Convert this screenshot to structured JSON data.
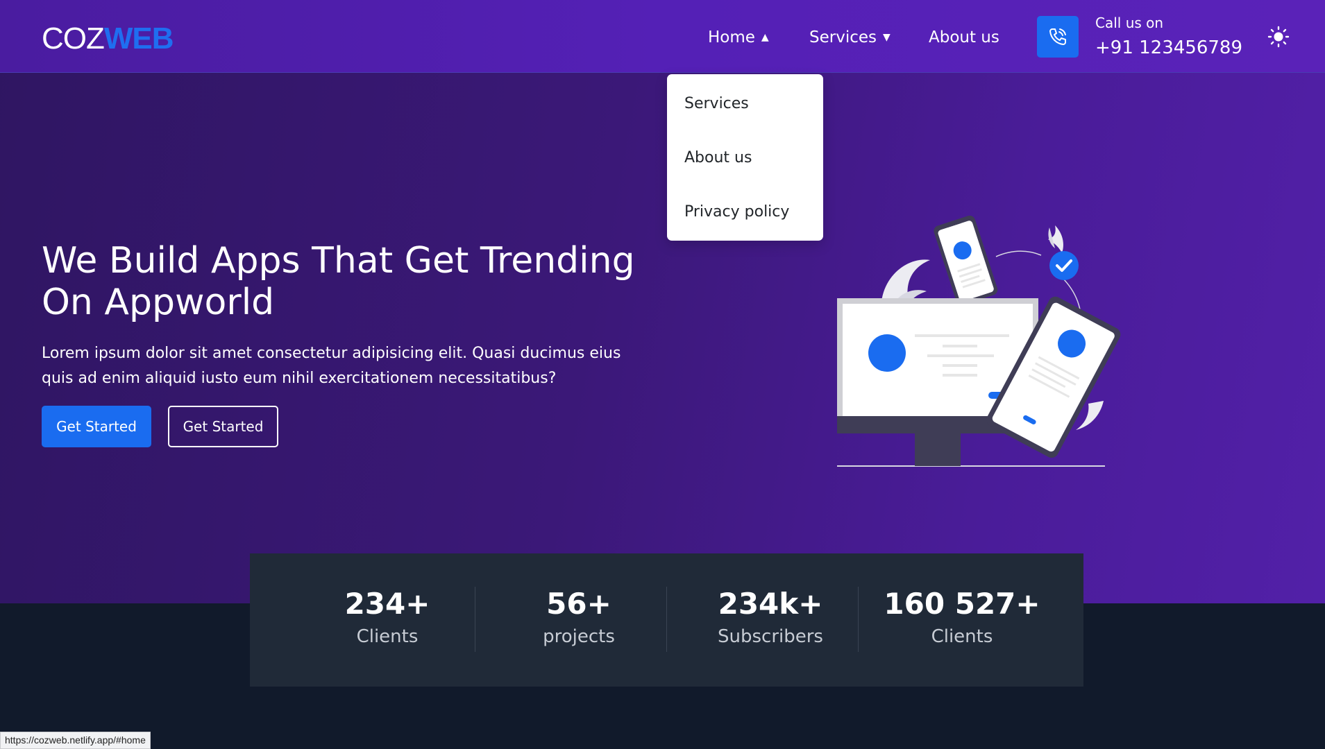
{
  "brand": {
    "part1": "COZ",
    "part2": "WEB"
  },
  "nav": {
    "home": "Home",
    "services": "Services",
    "about": "About us",
    "call_label": "Call us on",
    "call_number": "+91 123456789"
  },
  "dropdown": {
    "items": [
      "Services",
      "About us",
      "Privacy policy"
    ]
  },
  "hero": {
    "title": "We Build Apps That Get Trending On Appworld",
    "text": "Lorem ipsum dolor sit amet consectetur adipisicing elit. Quasi ducimus eius quis ad enim aliquid iusto eum nihil exercitationem necessitatibus?",
    "primary_button": "Get Started",
    "secondary_button": "Get Started"
  },
  "stats": [
    {
      "value": "234+",
      "label": "Clients"
    },
    {
      "value": "56+",
      "label": "projects"
    },
    {
      "value": "234k+",
      "label": "Subscribers"
    },
    {
      "value": "160 527+",
      "label": "Clients"
    }
  ],
  "status_bar": {
    "url": "https://cozweb.netlify.app/#home"
  },
  "colors": {
    "accent": "#1a6cf0",
    "hero_bg": "#3b1878",
    "stats_bg": "#202a38",
    "page_bg": "#111a2b"
  },
  "icons": {
    "phone": "phone-call-icon",
    "theme": "sun-icon",
    "caret_up": "caret-up-icon",
    "caret_down": "caret-down-icon"
  }
}
